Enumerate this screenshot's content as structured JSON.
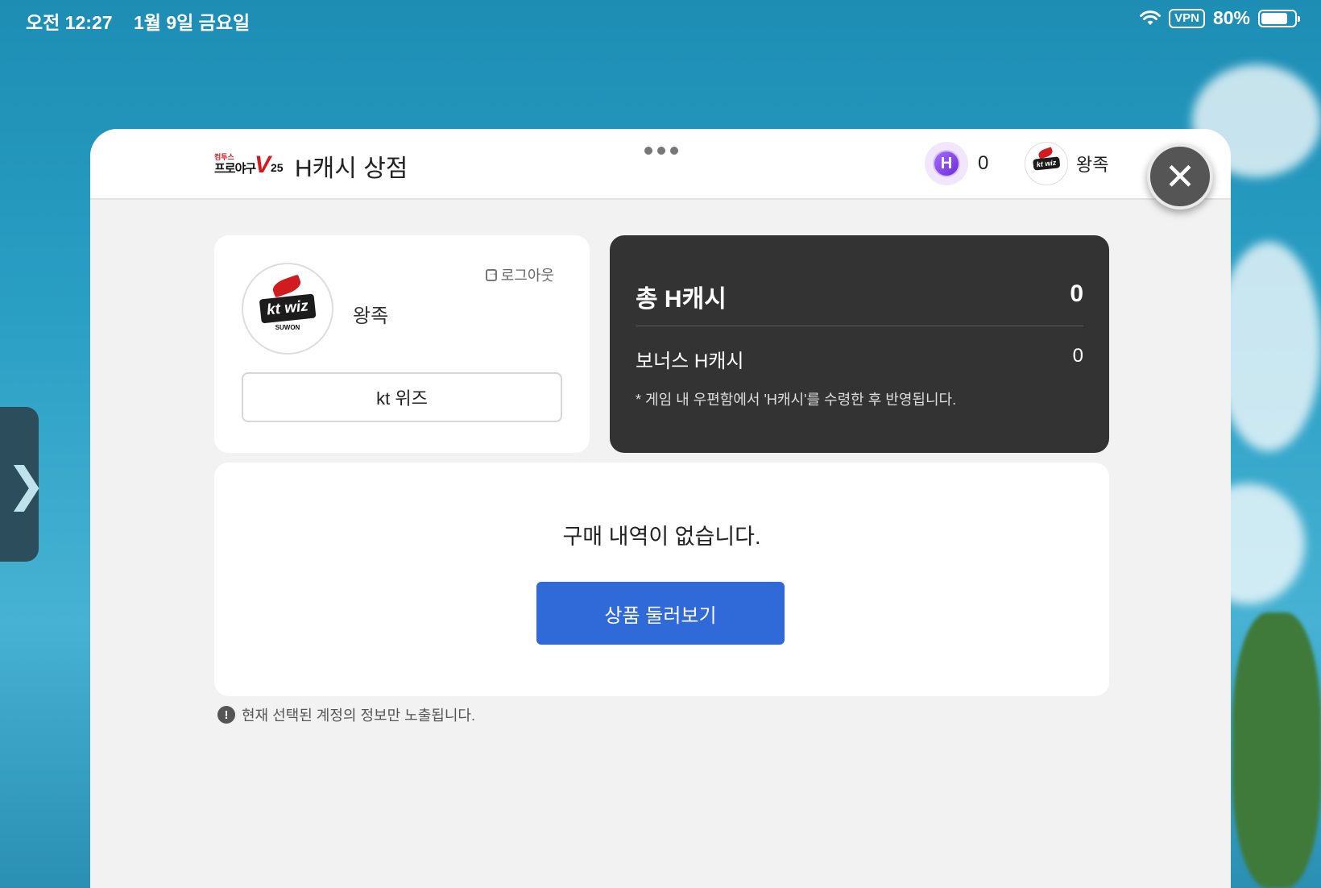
{
  "status_bar": {
    "time": "오전 12:27",
    "date": "1월 9일 금요일",
    "vpn": "VPN",
    "battery": "80%",
    "battery_level": 0.8
  },
  "header": {
    "brand_top": "컴투스",
    "brand_main": "프로야구",
    "brand_v": "V",
    "brand_year": "25",
    "title": "H캐시 상점",
    "cash_icon_letter": "H",
    "cash_value": "0",
    "user_name": "왕족",
    "close_label": "✕"
  },
  "profile": {
    "logout_label": "로그아웃",
    "team_logo_text": "kt wiz",
    "team_logo_sub": "SUWON",
    "name": "왕족",
    "team_button": "kt 위즈"
  },
  "cash": {
    "total_label": "총 H캐시",
    "total_value": "0",
    "bonus_label": "보너스 H캐시",
    "bonus_value": "0",
    "note": "* 게임 내 우편함에서 'H캐시'를 수령한 후 반영됩니다."
  },
  "history": {
    "empty_message": "구매 내역이 없습니다.",
    "browse_button": "상품 둘러보기"
  },
  "footer_note": {
    "icon": "!",
    "text": "현재 선택된 계정의 정보만 노출됩니다."
  },
  "colors": {
    "accent_button": "#2f6ad8",
    "cash_card": "#333333",
    "brand_red": "#d11b1f"
  }
}
